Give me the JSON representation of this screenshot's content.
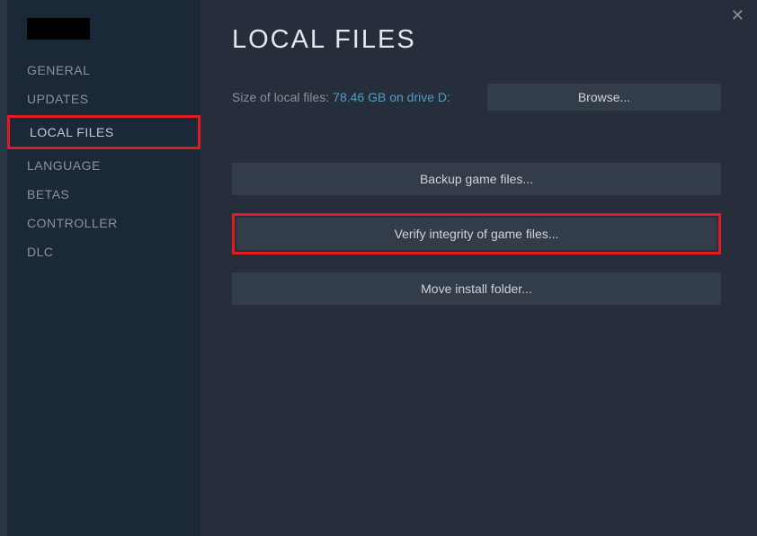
{
  "sidebar": {
    "items": [
      {
        "label": "GENERAL"
      },
      {
        "label": "UPDATES"
      },
      {
        "label": "LOCAL FILES"
      },
      {
        "label": "LANGUAGE"
      },
      {
        "label": "BETAS"
      },
      {
        "label": "CONTROLLER"
      },
      {
        "label": "DLC"
      }
    ]
  },
  "main": {
    "title": "LOCAL FILES",
    "size_label": "Size of local files:",
    "size_value": "78.46 GB on drive D:",
    "browse_label": "Browse...",
    "backup_label": "Backup game files...",
    "verify_label": "Verify integrity of game files...",
    "move_label": "Move install folder..."
  }
}
